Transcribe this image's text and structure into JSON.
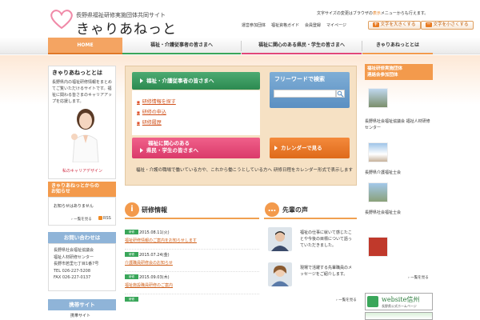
{
  "header": {
    "subtitle": "長野県福祉研修実施団体共同サイト",
    "title": "きゃりあねっと",
    "links": [
      "運営参加団体",
      "福祉資格ガイド",
      "会員登録",
      "マイページ"
    ],
    "notice_pre": "文字サイズの変更はブラウザの",
    "notice_hl": "表示",
    "notice_post": "メニューからも行えます。",
    "font_big": "文字を大きくする",
    "font_small": "文字を小さくする"
  },
  "nav": {
    "items": [
      "HOME",
      "福祉・介護従事者の皆さまへ",
      "福祉に関心のある県民・学生の皆さまへ",
      "きゃりあねっととは"
    ]
  },
  "about": {
    "title": "きゃりあねっととは",
    "text": "長野県内の福祉研修情報をまとめてご覧いただけるサイトです。福祉に関わる皆さまのキャリアアップを応援します。",
    "career_label": "私のキャリアデザイン"
  },
  "notice": {
    "line1": "きゃりあねっとからの",
    "line2": "お知らせ",
    "text": "お知らせはありません",
    "more": "一覧を見る",
    "rss": "RSS"
  },
  "contact": {
    "title": "お問い合わせは",
    "lines": [
      "長野県社会福祉協議会",
      "福祉人材研修センター",
      "長野市若里七丁目1番7号",
      "TEL 026-227-5208",
      "FAX 026-227-0137"
    ]
  },
  "mobile": {
    "title": "携帯サイト",
    "text": "携帯サイト"
  },
  "center": {
    "worker_btn": "福祉・介護従事者の皆さまへ",
    "list": [
      "研修情報を探す",
      "研修の申込",
      "研修履歴"
    ],
    "public_btn_1": "福祉に関心のある",
    "public_btn_2": "県民・学生の皆さまへ",
    "search_title": "フリーワードで検索",
    "calendar_btn": "カレンダーで見る",
    "worker_desc": "福祉・介護の職場で働いている方や、これから働こうとしている方へ",
    "calendar_desc": "研修日程をカレンダー形式で表示します"
  },
  "training": {
    "title": "研修情報",
    "items": [
      {
        "badge": "研修",
        "date": "2015.08.11(火)",
        "link": "福祉研修情報のご案内をお知らせします"
      },
      {
        "badge": "研修",
        "date": "2015.07.24(金)",
        "link": "介護職員研修会のお知らせ"
      },
      {
        "badge": "研修",
        "date": "2015.09.03(木)",
        "link": "福祉施設職員研修のご案内"
      },
      {
        "badge": "研修",
        "date": "",
        "link": ""
      }
    ]
  },
  "voices": {
    "title": "先輩の声",
    "items": [
      "福祉の仕事に就いて感じたことや今後の目標について語っていただきました。",
      "現場で活躍する先輩職員のメッセージをご紹介します。"
    ],
    "more": "一覧を見る"
  },
  "right": {
    "header_1": "福祉研修実施団体",
    "header_2": "連絡会参加団体",
    "items": [
      "長野県社会福祉協議会 福祉人材研修センター",
      "長野県介護福祉士会",
      "長野県社会福祉士会"
    ],
    "more": "一覧を見る",
    "banner_title": "website信州",
    "banner_sub": "長野県公式ホームページ"
  },
  "colors": {
    "accent_orange": "#f39a4c",
    "green": "#3aa65a",
    "pink": "#e24877",
    "blue": "#6b9bcb"
  }
}
